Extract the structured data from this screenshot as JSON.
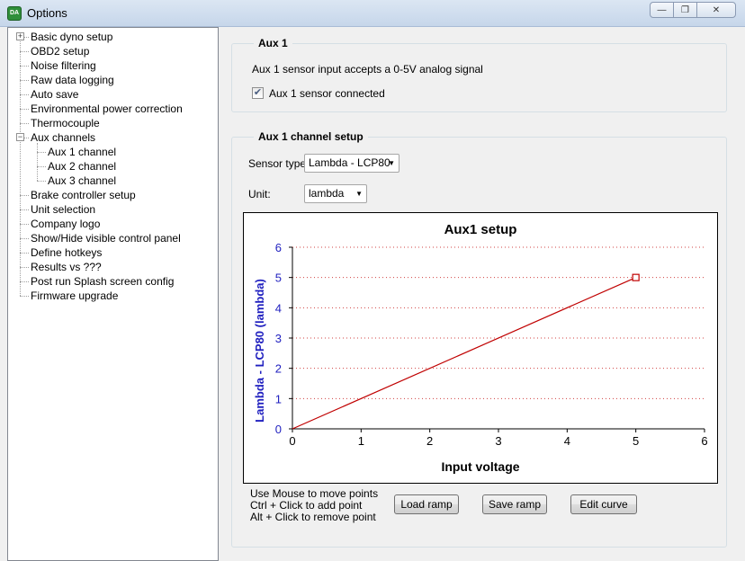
{
  "window": {
    "title": "Options",
    "app_icon_text": "DA"
  },
  "tree": {
    "items": [
      {
        "label": "Basic dyno setup",
        "level": 0,
        "expander": "+"
      },
      {
        "label": "OBD2 setup",
        "level": 0
      },
      {
        "label": "Noise filtering",
        "level": 0
      },
      {
        "label": "Raw data logging",
        "level": 0
      },
      {
        "label": "Auto save",
        "level": 0
      },
      {
        "label": "Environmental power correction",
        "level": 0
      },
      {
        "label": "Thermocouple",
        "level": 0
      },
      {
        "label": "Aux channels",
        "level": 0,
        "expander": "-"
      },
      {
        "label": "Aux 1 channel",
        "level": 1
      },
      {
        "label": "Aux 2 channel",
        "level": 1
      },
      {
        "label": "Aux 3 channel",
        "level": 1
      },
      {
        "label": "Brake controller setup",
        "level": 0
      },
      {
        "label": "Unit selection",
        "level": 0
      },
      {
        "label": "Company logo",
        "level": 0
      },
      {
        "label": "Show/Hide visible control panel",
        "level": 0
      },
      {
        "label": "Define hotkeys",
        "level": 0
      },
      {
        "label": "Results vs ???",
        "level": 0
      },
      {
        "label": "Post run Splash screen config",
        "level": 0
      },
      {
        "label": "Firmware upgrade",
        "level": 0
      }
    ]
  },
  "aux_group": {
    "title": "Aux 1",
    "description": "Aux 1 sensor input accepts a 0-5V analog signal",
    "checkbox_label": "Aux 1 sensor connected",
    "checkbox_checked": true
  },
  "setup_group": {
    "title": "Aux 1 channel setup",
    "sensor_type_label": "Sensor type:",
    "sensor_type_value": "Lambda - LCP80",
    "unit_label": "Unit:",
    "unit_value": "lambda",
    "help_lines": [
      "Use Mouse to move points",
      "Ctrl + Click to add point",
      "Alt + Click to remove point"
    ],
    "buttons": {
      "load": "Load ramp",
      "save": "Save ramp",
      "edit": "Edit curve"
    }
  },
  "chart_data": {
    "type": "line",
    "title": "Aux1 setup",
    "xlabel": "Input voltage",
    "ylabel": "Lambda - LCP80 (lambda)",
    "xlim": [
      0,
      6
    ],
    "ylim": [
      0,
      6
    ],
    "x_ticks": [
      "0",
      "1",
      "2",
      "3",
      "4",
      "5",
      "6"
    ],
    "y_ticks": [
      "0",
      "1",
      "2",
      "3",
      "4",
      "5",
      "6"
    ],
    "grid": true,
    "series": [
      {
        "x": [
          0,
          5
        ],
        "y": [
          0,
          5
        ],
        "color": "#c00000",
        "marker_last": "square"
      }
    ]
  }
}
